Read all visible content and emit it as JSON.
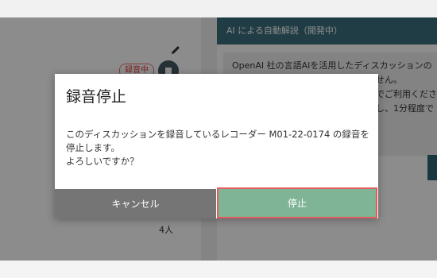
{
  "background": {
    "recording_badge": "録音中",
    "participants": "4人",
    "ai_panel": {
      "title": "AI による自動解説（開発中）",
      "lines": [
        "OpenAI 社の言語AIを活用したディスカッションの",
        "せん。",
        "でご利用くださ",
        "し、1分程度で"
      ]
    }
  },
  "dialog": {
    "title": "録音停止",
    "message": "このディスカッションを録音しているレコーダー M01-22-0174 の録音を\n停止します。\nよろしいですか？",
    "cancel_label": "キャンセル",
    "confirm_label": "停止"
  },
  "colors": {
    "cancel": "#757575",
    "confirm": "#7fb596",
    "confirm_border": "#e35b5b",
    "panel_header": "#3b6f7e"
  }
}
